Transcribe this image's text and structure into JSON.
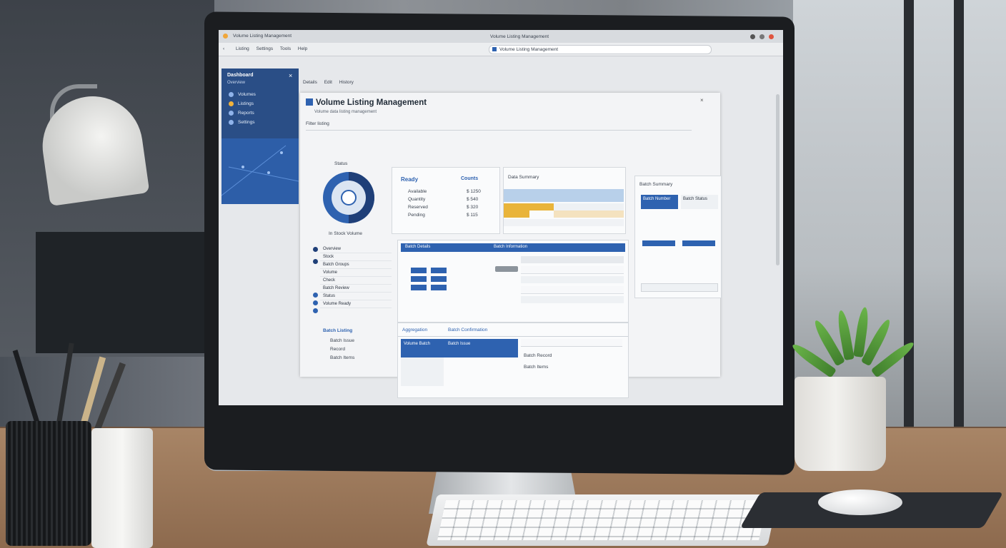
{
  "browser": {
    "tab_title": "Volume Listing Management",
    "nav_items": [
      "Listing",
      "Settings",
      "Tools",
      "Help"
    ],
    "address": "Volume Listing Management",
    "back": "‹"
  },
  "sidebar": {
    "title": "Dashboard",
    "subtitle": "Overview",
    "items": [
      "Volumes",
      "Listings",
      "Reports",
      "Settings"
    ]
  },
  "panel": {
    "tabs": [
      "Details",
      "Edit",
      "History"
    ],
    "title": "Volume Listing Management",
    "subtitle": "Volume data listing management",
    "filter_label": "Filter listing",
    "donut_title": "Status",
    "donut_caption": "In Stock Volume",
    "stats_title": "Ready",
    "stats_rows": [
      {
        "label": "Available",
        "value": "$ 1250"
      },
      {
        "label": "Quantity",
        "value": "$ 540"
      },
      {
        "label": "Reserved",
        "value": "$ 320"
      },
      {
        "label": "Pending",
        "value": "$ 115"
      }
    ],
    "counts_title": "Counts",
    "grid_title": "Data Summary",
    "list_items": [
      "Overview",
      "Stock",
      "Batch Groups",
      "Volume",
      "Check",
      "Batch Review",
      "Status",
      "Volume Ready"
    ],
    "section_footer": "Batch Listing",
    "footer_items": [
      "Batch Issue",
      "Record",
      "Batch Items"
    ],
    "table_title": "Batch Details",
    "table_col2": "Batch Information",
    "right_title": "Batch Summary",
    "right_card_a": "Batch Number",
    "right_card_b": "Batch Status",
    "bottom_tabs": [
      "Aggregation",
      "Batch Confirmation"
    ],
    "bottom_rows": [
      "Volume Batch",
      "Batch Issue",
      "Batch Record",
      "Batch Items"
    ]
  },
  "colors": {
    "primary": "#2e62b0",
    "accent": "#e9b43a",
    "sidebar": "#2d5ea8"
  }
}
